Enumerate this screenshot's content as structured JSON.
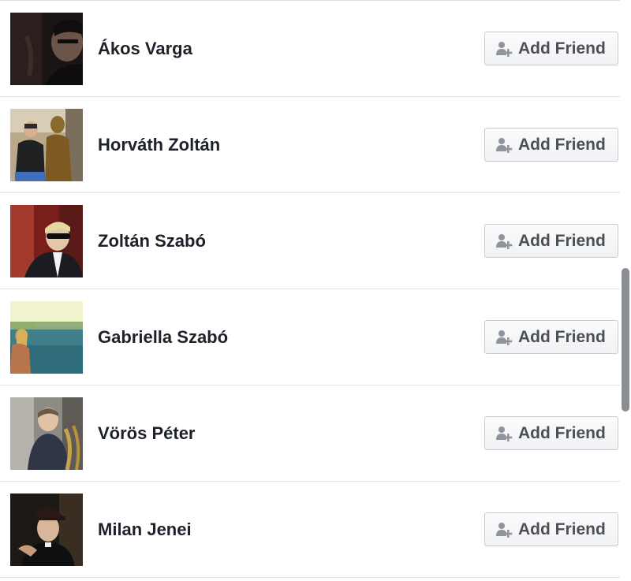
{
  "friend_suggestions": [
    {
      "name": "Ákos Varga",
      "button_label": "Add Friend",
      "avatar_icon": "profile-photo"
    },
    {
      "name": "Horváth Zoltán",
      "button_label": "Add Friend",
      "avatar_icon": "profile-photo"
    },
    {
      "name": "Zoltán Szabó",
      "button_label": "Add Friend",
      "avatar_icon": "profile-photo"
    },
    {
      "name": "Gabriella Szabó",
      "button_label": "Add Friend",
      "avatar_icon": "profile-photo"
    },
    {
      "name": "Vörös Péter",
      "button_label": "Add Friend",
      "avatar_icon": "profile-photo"
    },
    {
      "name": "Milan Jenei",
      "button_label": "Add Friend",
      "avatar_icon": "profile-photo"
    }
  ],
  "button_icon": "add-friend-icon",
  "colors": {
    "name_text": "#1d2129",
    "button_text": "#4b4f56",
    "button_border": "#c8cbd1",
    "divider": "#e2e3e6",
    "scroll_thumb": "#8a8d91"
  }
}
